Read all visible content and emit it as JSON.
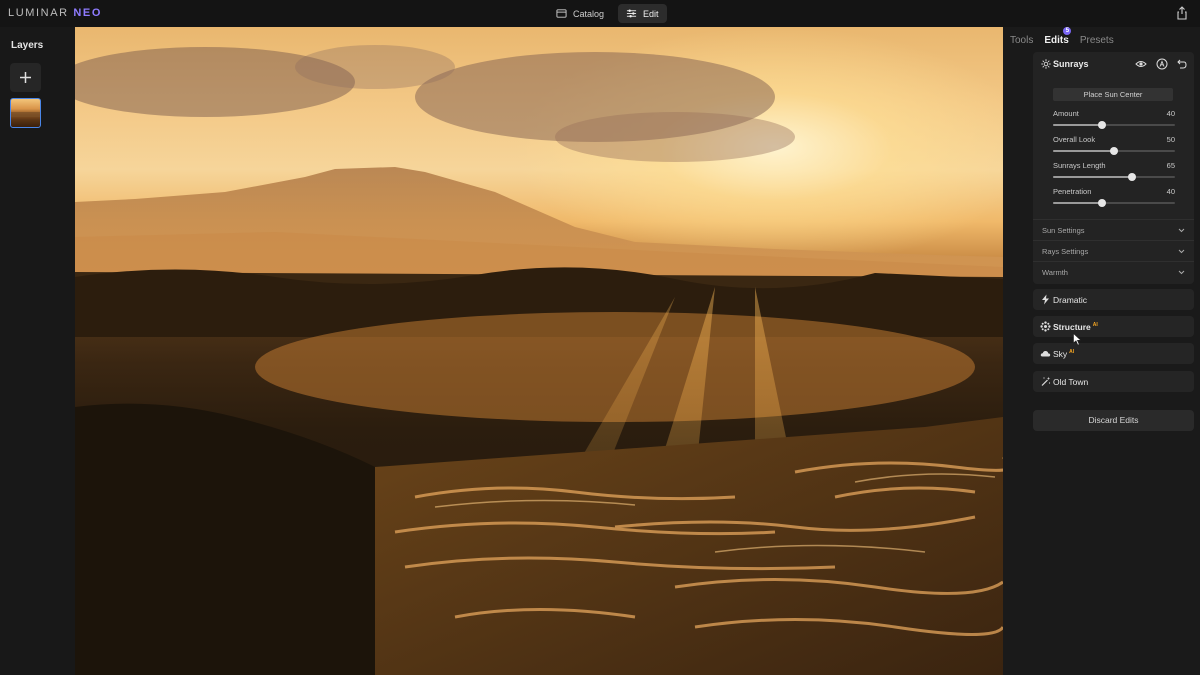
{
  "app": {
    "logo_main": "LUMINAR",
    "logo_accent": "NEO"
  },
  "topbar": {
    "modes": [
      {
        "label": "Catalog",
        "icon": "catalog-icon",
        "active": false
      },
      {
        "label": "Edit",
        "icon": "edit-sliders-icon",
        "active": true
      }
    ],
    "share_icon": "share-icon"
  },
  "layers_panel": {
    "title": "Layers",
    "add_icon": "plus-icon"
  },
  "right_panel": {
    "tabs": [
      {
        "label": "Tools",
        "active": false
      },
      {
        "label": "Edits",
        "active": true,
        "badge": "5"
      },
      {
        "label": "Presets",
        "active": false
      }
    ],
    "sunrays": {
      "title": "Sunrays",
      "icon": "sunrays-icon",
      "actions": [
        "eye-icon",
        "ai-icon",
        "undo-icon"
      ],
      "place_sun_button": "Place Sun Center",
      "sliders": [
        {
          "label": "Amount",
          "value": 40,
          "min": 0,
          "max": 100
        },
        {
          "label": "Overall Look",
          "value": 50,
          "min": 0,
          "max": 100
        },
        {
          "label": "Sunrays Length",
          "value": 65,
          "min": 0,
          "max": 100
        },
        {
          "label": "Penetration",
          "value": 40,
          "min": 0,
          "max": 100
        }
      ],
      "sections": [
        "Sun Settings",
        "Rays Settings",
        "Warmth"
      ]
    },
    "tools": [
      {
        "label": "Dramatic",
        "icon": "lightning-icon",
        "ai": false,
        "bold": false
      },
      {
        "label": "Structure",
        "icon": "structure-icon",
        "ai": true,
        "bold": true
      },
      {
        "label": "Sky",
        "icon": "cloud-icon",
        "ai": true,
        "bold": false
      },
      {
        "label": "Old Town",
        "icon": "magic-wand-icon",
        "ai": false,
        "bold": false
      }
    ],
    "ai_badge": "AI",
    "discard_button": "Discard Edits"
  },
  "colors": {
    "accent": "#7b67f5",
    "ai_badge": "#f5a623",
    "selection_border": "#4a86e8"
  }
}
